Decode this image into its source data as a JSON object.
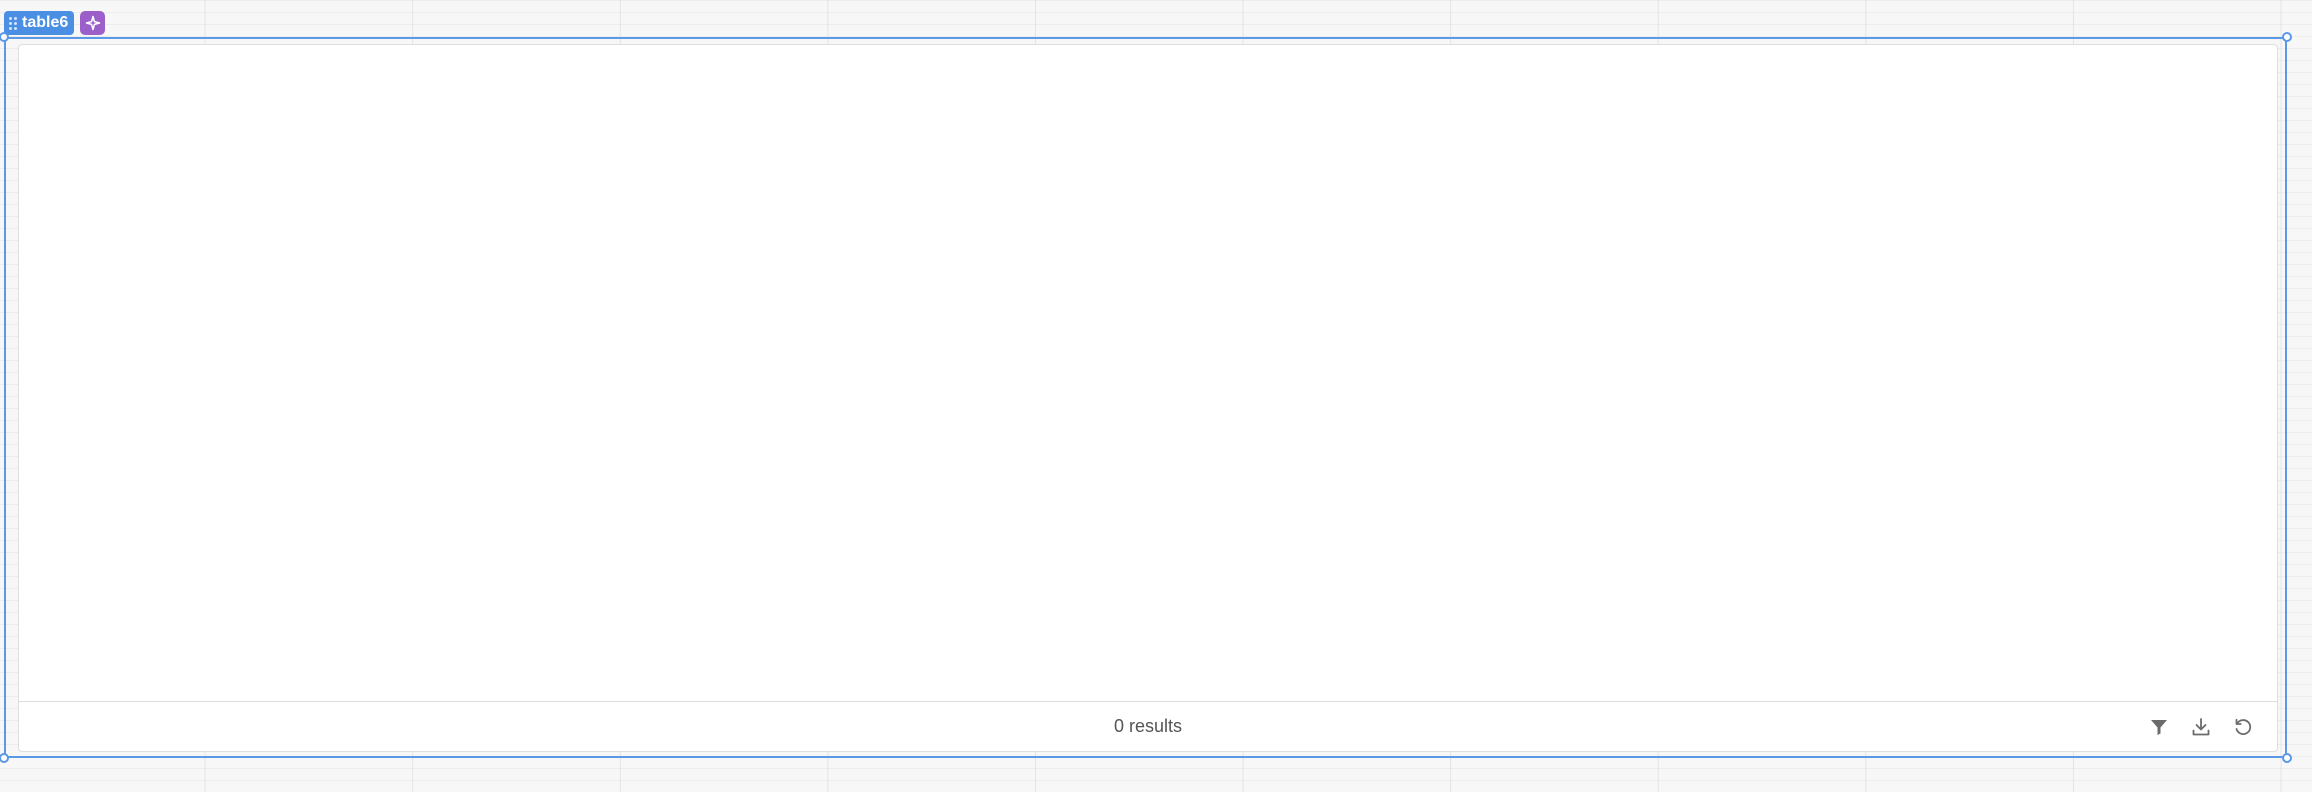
{
  "component": {
    "name": "table6",
    "accent_color": "#4a8fe4",
    "ai_button_color": "#9c5fc9",
    "icons": {
      "drag": "drag-dots-icon",
      "ai": "sparkle-icon"
    }
  },
  "table": {
    "footer": {
      "results_text": "0 results",
      "actions": [
        {
          "name": "filter",
          "icon": "filter-icon"
        },
        {
          "name": "download",
          "icon": "download-icon"
        },
        {
          "name": "refresh",
          "icon": "refresh-icon"
        }
      ]
    }
  }
}
